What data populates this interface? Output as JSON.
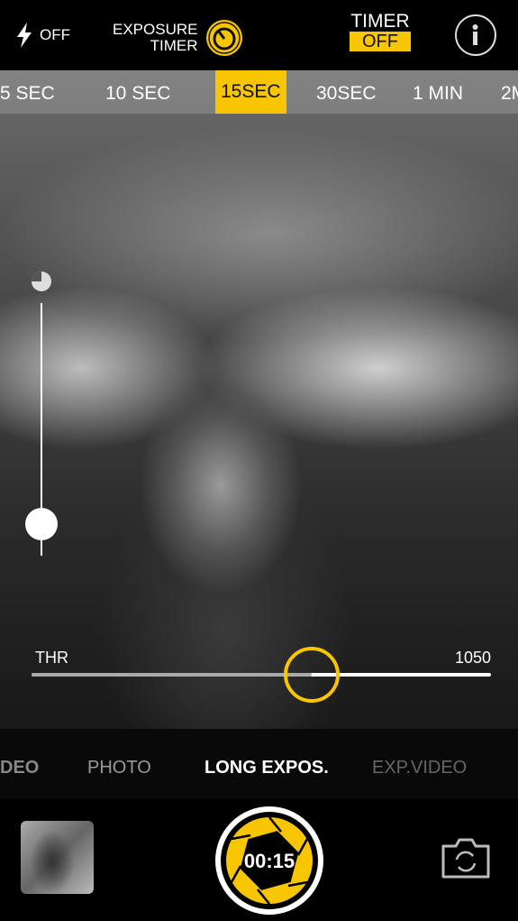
{
  "top": {
    "flash_label": "OFF",
    "flash_icon": "lightning-icon",
    "exposure_timer_line1": "EXPOSURE",
    "exposure_timer_line2": "TIMER",
    "timer_label": "TIMER",
    "timer_value": "OFF",
    "info_icon": "info-icon"
  },
  "durations": [
    {
      "label": "5 SEC"
    },
    {
      "label": "10 SEC"
    },
    {
      "label": "15SEC",
      "selected": true
    },
    {
      "label": "30SEC"
    },
    {
      "label": "1 MIN"
    },
    {
      "label": "2M"
    }
  ],
  "threshold": {
    "label": "THR",
    "value": "1050",
    "fraction": 0.61
  },
  "exposure_slider": {
    "fraction": 0.06
  },
  "modes": [
    {
      "label": "DEO"
    },
    {
      "label": "PHOTO"
    },
    {
      "label": "LONG EXPOS.",
      "selected": true
    },
    {
      "label": "EXP.VIDEO"
    }
  ],
  "shutter": {
    "time": "00:15"
  },
  "colors": {
    "accent": "#f7c600"
  }
}
